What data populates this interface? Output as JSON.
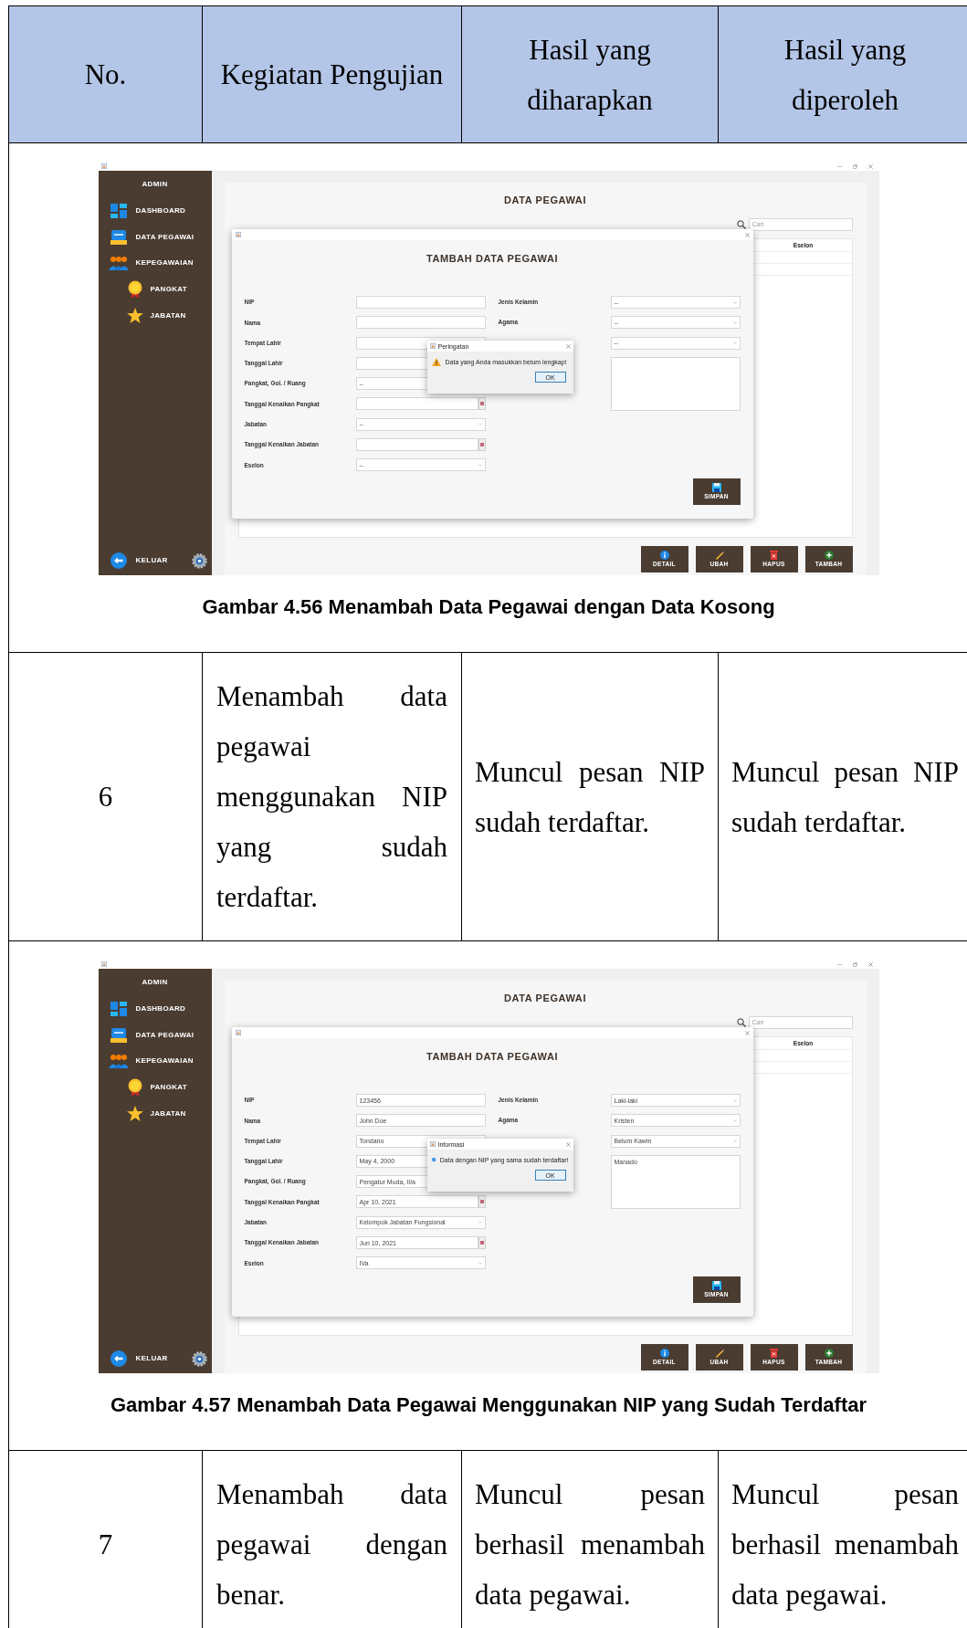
{
  "table": {
    "columns": [
      "No.",
      "Kegiatan Pengujian",
      "Hasil yang diharapkan",
      "Hasil yang diperoleh"
    ],
    "rows": [
      {
        "kind": "figure",
        "screenshot": {
          "sidebar": {
            "title": "ADMIN",
            "items": [
              {
                "label": "DASHBOARD",
                "kind": "dashboard"
              },
              {
                "label": "DATA PEGAWAI",
                "kind": "employee"
              },
              {
                "label": "KEPEGAWAIAN",
                "kind": "staff",
                "children": [
                  {
                    "label": "PANGKAT",
                    "kind": "rank"
                  },
                  {
                    "label": "JABATAN",
                    "kind": "position"
                  }
                ]
              }
            ],
            "logout": "KELUAR"
          },
          "page_title": "DATA PEGAWAI",
          "search_placeholder": "Cari",
          "table_column": "Eselon",
          "buttons": [
            {
              "label": "DETAIL",
              "kind": "info"
            },
            {
              "label": "UBAH",
              "kind": "edit"
            },
            {
              "label": "HAPUS",
              "kind": "delete"
            },
            {
              "label": "TAMBAH",
              "kind": "add"
            }
          ],
          "form": {
            "title": "TAMBAH DATA PEGAWAI",
            "left": [
              {
                "label": "NIP",
                "kind": "text"
              },
              {
                "label": "Nama",
                "kind": "text"
              },
              {
                "label": "Tempat Lahir",
                "kind": "text"
              },
              {
                "label": "Tanggal Lahir",
                "kind": "text"
              },
              {
                "label": "Pangkat, Gol. / Ruang",
                "kind": "text",
                "value": "--"
              },
              {
                "label": "Tanggal Kenaikan Pangkat",
                "kind": "date"
              },
              {
                "label": "Jabatan",
                "kind": "select",
                "value": "--"
              },
              {
                "label": "Tanggal Kenaikan Jabatan",
                "kind": "date"
              },
              {
                "label": "Eselon",
                "kind": "select",
                "value": "--"
              }
            ],
            "right": [
              {
                "label": "Jenis Kelamin",
                "kind": "select",
                "value": "--"
              },
              {
                "label": "Agama",
                "kind": "select",
                "value": "--"
              },
              {
                "kind": "select",
                "value": "--"
              },
              {
                "kind": "textarea"
              }
            ],
            "save": "SIMPAN"
          },
          "alert": {
            "kind": "warning",
            "title": "Peringatan",
            "message": "Data yang Anda masukkan belum lengkap!",
            "button": "OK"
          }
        },
        "caption": "Gambar 4.56 Menambah Data Pegawai dengan Data Kosong"
      },
      {
        "kind": "test",
        "no": "6",
        "activity": "Menambah data pegawai menggunakan NIP yang sudah terdaftar.",
        "expected": "Muncul pesan NIP sudah terdaftar.",
        "actual": "Muncul pesan NIP sudah terdaftar."
      },
      {
        "kind": "figure",
        "screenshot": {
          "sidebar": {
            "title": "ADMIN",
            "items": [
              {
                "label": "DASHBOARD",
                "kind": "dashboard"
              },
              {
                "label": "DATA PEGAWAI",
                "kind": "employee"
              },
              {
                "label": "KEPEGAWAIAN",
                "kind": "staff",
                "children": [
                  {
                    "label": "PANGKAT",
                    "kind": "rank"
                  },
                  {
                    "label": "JABATAN",
                    "kind": "position"
                  }
                ]
              }
            ],
            "logout": "KELUAR"
          },
          "page_title": "DATA PEGAWAI",
          "search_placeholder": "Cari",
          "table_column": "Eselon",
          "buttons": [
            {
              "label": "DETAIL",
              "kind": "info"
            },
            {
              "label": "UBAH",
              "kind": "edit"
            },
            {
              "label": "HAPUS",
              "kind": "delete"
            },
            {
              "label": "TAMBAH",
              "kind": "add"
            }
          ],
          "form": {
            "title": "TAMBAH DATA PEGAWAI",
            "left": [
              {
                "label": "NIP",
                "kind": "text",
                "value": "123456"
              },
              {
                "label": "Nama",
                "kind": "text",
                "value": "John Doe"
              },
              {
                "label": "Tempat Lahir",
                "kind": "text",
                "value": "Tondano"
              },
              {
                "label": "Tanggal Lahir",
                "kind": "text",
                "value": "May 4, 2000"
              },
              {
                "label": "Pangkat, Gol. / Ruang",
                "kind": "text",
                "value": "Pengatur Muda, II/a"
              },
              {
                "label": "Tanggal Kenaikan Pangkat",
                "kind": "date",
                "value": "Apr 10, 2021"
              },
              {
                "label": "Jabatan",
                "kind": "select",
                "value": "Kelompok Jabatan Fungsional"
              },
              {
                "label": "Tanggal Kenaikan Jabatan",
                "kind": "date",
                "value": "Jun 10, 2021"
              },
              {
                "label": "Eselon",
                "kind": "select",
                "value": "IVa"
              }
            ],
            "right": [
              {
                "label": "Jenis Kelamin",
                "kind": "select",
                "value": "Laki-laki"
              },
              {
                "label": "Agama",
                "kind": "select",
                "value": "Kristen"
              },
              {
                "kind": "select",
                "value": "Belum Kawin"
              },
              {
                "kind": "textarea",
                "value": "Manado"
              }
            ],
            "save": "SIMPAN"
          },
          "alert": {
            "kind": "info",
            "title": "Informasi",
            "message": "Data dengan NIP yang sama sudah terdaftar!",
            "button": "OK"
          }
        },
        "caption": "Gambar 4.57 Menambah Data Pegawai Menggunakan NIP yang Sudah Terdaftar"
      },
      {
        "kind": "test",
        "no": "7",
        "activity": "Menambah data pegawai dengan benar.",
        "expected": "Muncul pesan berhasil menambah data pegawai.",
        "actual": "Muncul pesan berhasil menambah data pegawai."
      }
    ]
  }
}
